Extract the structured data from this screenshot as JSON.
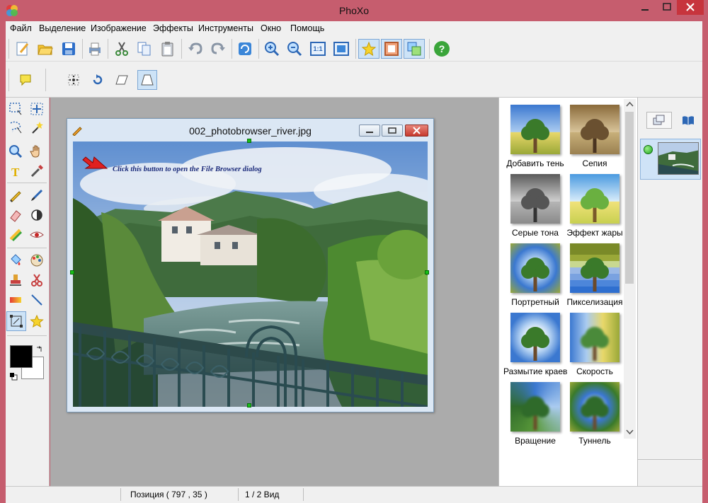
{
  "window": {
    "title": "PhoXo"
  },
  "menu": [
    "Файл",
    "Выделение",
    "Изображение",
    "Эффекты",
    "Инструменты",
    "Окно",
    "Помощь"
  ],
  "toolbar": {
    "buttons": [
      "new-icon",
      "open-folder-icon",
      "save-icon",
      "print-icon",
      "cut-icon",
      "copy-icon",
      "paste-icon",
      "undo-icon",
      "redo-icon",
      "refresh-icon",
      "zoom-in-icon",
      "zoom-out-icon",
      "actual-size-icon",
      "fit-window-icon",
      "star-icon",
      "frame-icon",
      "layers-icon",
      "help-icon"
    ],
    "actual_size_label": "1:1",
    "help_label": "?"
  },
  "document": {
    "filename": "002_photobrowser_river.jpg",
    "annotation": "Click this button to open the File Browser dialog"
  },
  "effects": [
    {
      "label": "Добавить тень",
      "style": "shadow"
    },
    {
      "label": "Сепия",
      "style": "sepia"
    },
    {
      "label": "Серые тона",
      "style": "gray"
    },
    {
      "label": "Эффект жары",
      "style": "heat"
    },
    {
      "label": "Портретный",
      "style": "portrait"
    },
    {
      "label": "Пикселизация",
      "style": "pixel"
    },
    {
      "label": "Размытие краев",
      "style": "blur"
    },
    {
      "label": "Скорость",
      "style": "speed"
    },
    {
      "label": "Вращение",
      "style": "rotate"
    },
    {
      "label": "Туннель",
      "style": "tunnel"
    }
  ],
  "colors": {
    "foreground": "#000000",
    "background": "#ffffff",
    "accent": "#c65d6e"
  },
  "status": {
    "position": "Позиция ( 797 , 35 )",
    "view": "1 / 2 Вид"
  }
}
